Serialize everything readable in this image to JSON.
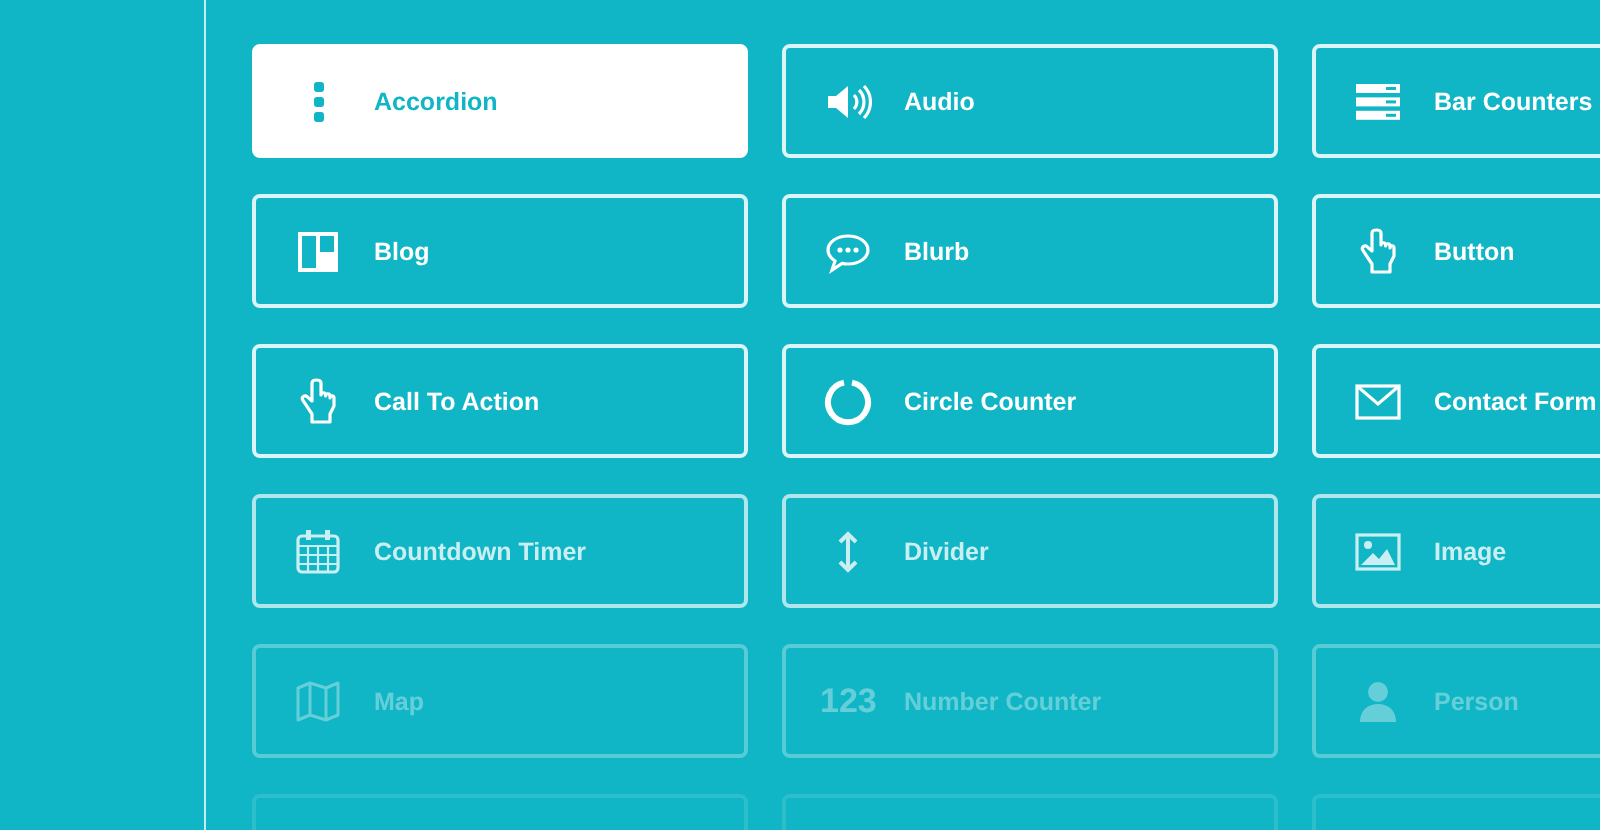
{
  "modules": [
    {
      "label": "Accordion",
      "selected": true
    },
    {
      "label": "Audio",
      "selected": false
    },
    {
      "label": "Bar Counters",
      "selected": false
    },
    {
      "label": "Blog",
      "selected": false
    },
    {
      "label": "Blurb",
      "selected": false
    },
    {
      "label": "Button",
      "selected": false
    },
    {
      "label": "Call To Action",
      "selected": false
    },
    {
      "label": "Circle Counter",
      "selected": false
    },
    {
      "label": "Contact Form",
      "selected": false
    },
    {
      "label": "Countdown Timer",
      "selected": false
    },
    {
      "label": "Divider",
      "selected": false
    },
    {
      "label": "Image",
      "selected": false
    },
    {
      "label": "Map",
      "selected": false
    },
    {
      "label": "Number Counter",
      "selected": false,
      "icon_text": "123"
    },
    {
      "label": "Person",
      "selected": false
    }
  ]
}
